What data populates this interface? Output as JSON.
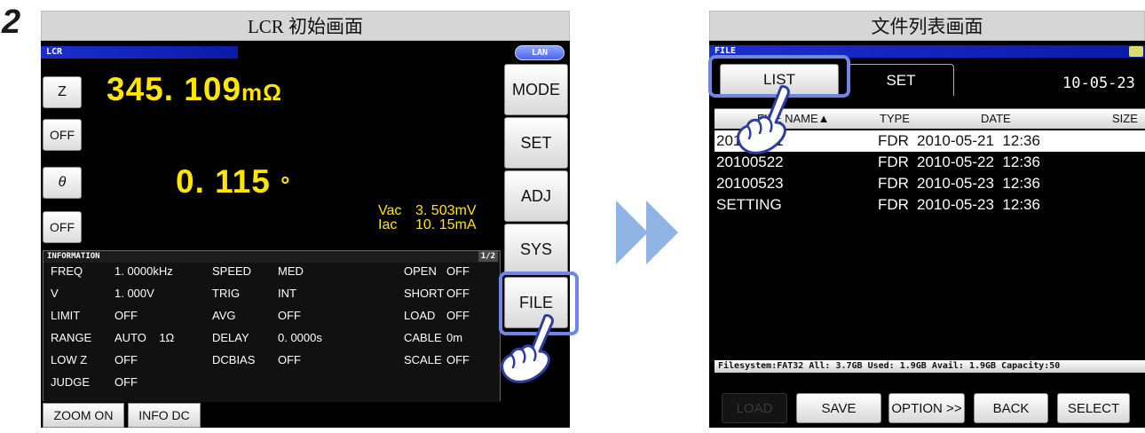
{
  "step": {
    "number": "2"
  },
  "left_panel": {
    "title": "LCR 初始画面",
    "header": {
      "mode_label": "LCR",
      "lan_label": "LAN"
    },
    "params": [
      {
        "label": "Z"
      },
      {
        "label": "OFF"
      },
      {
        "label": "θ"
      },
      {
        "label": "OFF"
      }
    ],
    "measure1": {
      "value": "345. 109",
      "unit": "mΩ"
    },
    "measure2": {
      "value": "0. 115",
      "unit": "°"
    },
    "monitor": {
      "vac_label": "Vac",
      "vac_value": "3. 503mV",
      "iac_label": "Iac",
      "iac_value": "10. 15mA"
    },
    "side_buttons": [
      "MODE",
      "SET",
      "ADJ",
      "SYS",
      "FILE"
    ],
    "info": {
      "header": "INFORMATION",
      "page": "1/2",
      "rows": [
        [
          "FREQ",
          "1. 0000kHz",
          "SPEED",
          "MED",
          "OPEN",
          "OFF"
        ],
        [
          "V",
          "1. 000V",
          "TRIG",
          "INT",
          "SHORT",
          "OFF"
        ],
        [
          "LIMIT",
          "OFF",
          "AVG",
          "OFF",
          "LOAD",
          "OFF"
        ],
        [
          "RANGE",
          "AUTO    1Ω",
          "DELAY",
          "0. 0000s",
          "CABLE",
          "0m"
        ],
        [
          "LOW Z",
          "OFF",
          "DCBIAS",
          "OFF",
          "SCALE",
          "OFF"
        ],
        [
          "JUDGE",
          "OFF",
          "",
          "",
          "",
          ""
        ]
      ]
    },
    "bottom_buttons": [
      "ZOOM ON",
      "INFO DC"
    ]
  },
  "right_panel": {
    "title": "文件列表画面",
    "header": {
      "mode_label": "FILE"
    },
    "tabs": [
      "LIST",
      "SET"
    ],
    "date": "10-05-23",
    "columns": [
      "FILE NAME▲",
      "TYPE",
      "DATE",
      "SIZE"
    ],
    "files": [
      {
        "name": "20100521",
        "type": "FDR",
        "date": "2010-05-21  12:36",
        "selected": true
      },
      {
        "name": "20100522",
        "type": "FDR",
        "date": "2010-05-22  12:36",
        "selected": false
      },
      {
        "name": "20100523",
        "type": "FDR",
        "date": "2010-05-23  12:36",
        "selected": false
      },
      {
        "name": "SETTING",
        "type": "FDR",
        "date": "2010-05-23  12:36",
        "selected": false
      }
    ],
    "fs_status": "Filesystem:FAT32  All:  3.7GB  Used:  1.9GB  Avail:  1.9GB  Capacity:50",
    "buttons": {
      "load": "LOAD",
      "save": "SAVE",
      "option": "OPTION >>",
      "back": "BACK",
      "select": "SELECT"
    }
  },
  "colors": {
    "accent": "#6f86e6",
    "value_yellow": "#ffe600",
    "title_bar_blue": "#1b2fd0"
  }
}
